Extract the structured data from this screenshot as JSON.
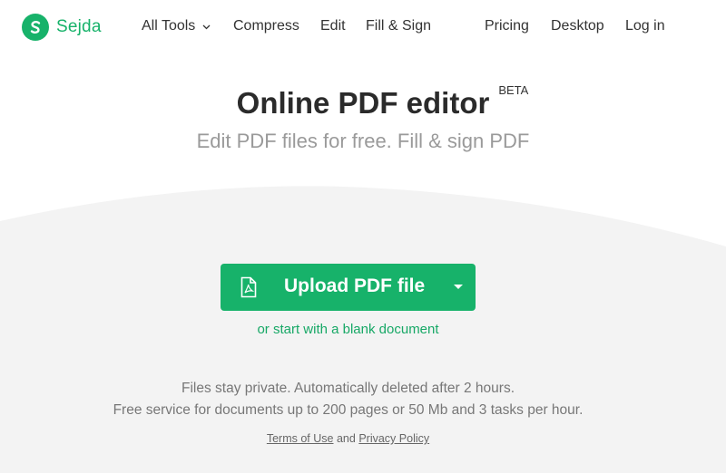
{
  "brand": {
    "name": "Sejda",
    "color": "#17b26a"
  },
  "nav": {
    "all_tools": "All Tools",
    "compress": "Compress",
    "edit": "Edit",
    "fill_sign": "Fill & Sign",
    "pricing": "Pricing",
    "desktop": "Desktop",
    "login": "Log in"
  },
  "hero": {
    "title": "Online PDF editor",
    "badge": "BETA",
    "subtitle": "Edit PDF files for free. Fill & sign PDF"
  },
  "upload": {
    "label": "Upload PDF file",
    "blank_link": "or start with a blank document"
  },
  "info": {
    "line1": "Files stay private. Automatically deleted after 2 hours.",
    "line2": "Free service for documents up to 200 pages or 50 Mb and 3 tasks per hour."
  },
  "legal": {
    "terms": "Terms of Use",
    "and": "and",
    "privacy": "Privacy Policy"
  },
  "icons": {
    "logo": "sejda-logo-icon",
    "dropdown": "chevron-down-icon",
    "pdf": "pdf-file-icon",
    "caret": "caret-down-icon"
  }
}
